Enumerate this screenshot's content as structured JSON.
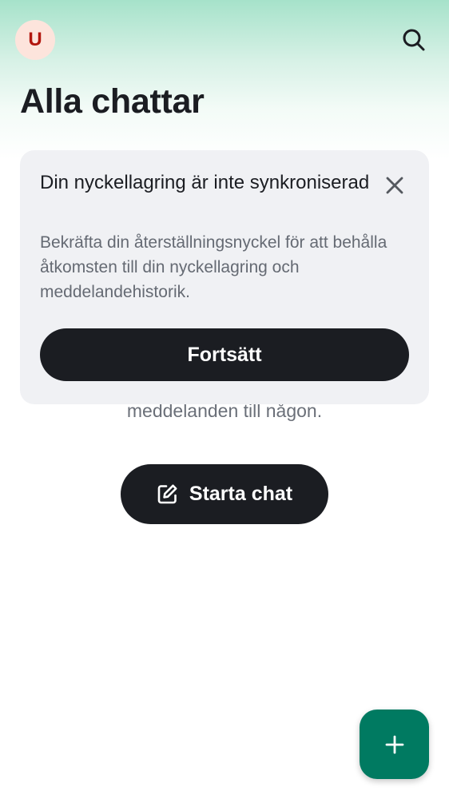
{
  "header": {
    "avatar_letter": "U",
    "title": "Alla chattar",
    "search_icon": "search-icon"
  },
  "empty_state": {
    "text_visible": "meddelanden till någon.",
    "start_chat_label": "Starta chat",
    "start_chat_icon": "compose-icon"
  },
  "banner": {
    "title": "Din nyckellagring är inte synkroniserad",
    "body": "Bekräfta din återställningsnyckel för att behålla åtkomsten till din nyckellagring och meddelandehistorik.",
    "continue_label": "Fortsätt",
    "close_icon": "close-icon"
  },
  "fab": {
    "icon": "plus-icon"
  },
  "colors": {
    "accent": "#007a61",
    "dark_button": "#1b1d22",
    "avatar_bg": "#fde4dc",
    "avatar_text": "#b2160e",
    "banner_bg": "#f0f1f4",
    "gradient_top": "#a6e2ca"
  }
}
